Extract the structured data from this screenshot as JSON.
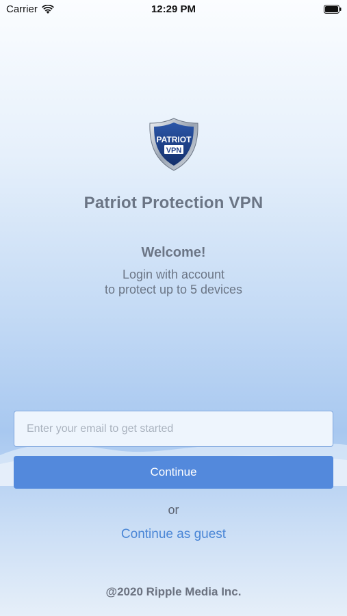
{
  "status_bar": {
    "carrier": "Carrier",
    "time": "12:29 PM"
  },
  "logo": {
    "line1": "PATRIOT",
    "line2": "VPN",
    "icon": "shield-icon"
  },
  "app_title": "Patriot Protection VPN",
  "welcome": {
    "heading": "Welcome!",
    "line1": "Login with account",
    "line2": "to protect up to 5 devices"
  },
  "form": {
    "email_placeholder": "Enter your email to get started",
    "email_value": "",
    "continue_label": "Continue",
    "or_label": "or",
    "guest_label": "Continue as guest"
  },
  "footer": "@2020 Ripple Media Inc.",
  "colors": {
    "primary_button": "#5389dc",
    "link": "#4a86d6",
    "logo_blue": "#1f3f8a",
    "logo_silver": "#b8c0cc"
  }
}
